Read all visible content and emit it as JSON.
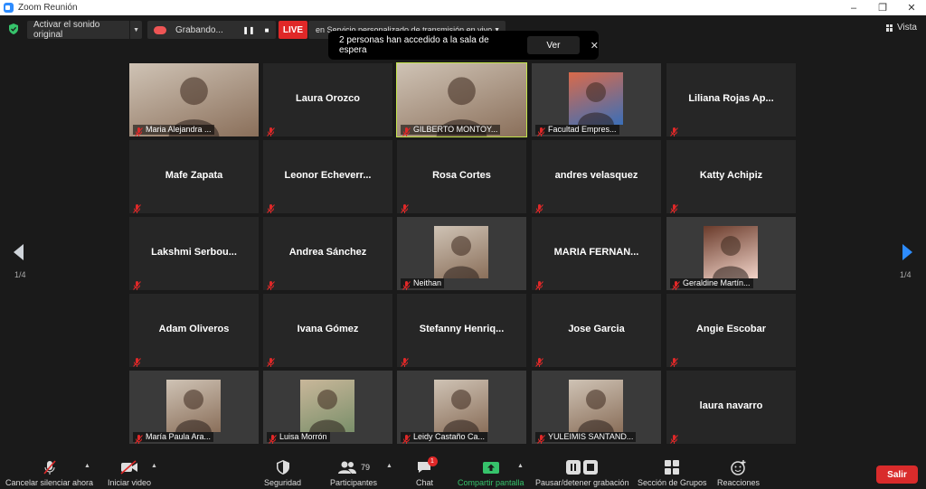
{
  "window": {
    "title": "Zoom Reunión",
    "controls": [
      "–",
      "❐",
      "✕"
    ]
  },
  "topbar": {
    "original_sound": "Activar el sonido original",
    "recording": "Grabando...",
    "live": "LIVE",
    "stream_service": "en Servicio personalizado de transmisión en vivo",
    "view": "Vista"
  },
  "notification": {
    "message": "2 personas han accedido a la sala de espera",
    "view_button": "Ver"
  },
  "gallery": {
    "page_left": "1/4",
    "page_right": "1/4",
    "tiles": [
      {
        "name": "Maria Alejandra ...",
        "video": true,
        "thumb": "portrait"
      },
      {
        "name": "Laura Orozco",
        "video": false
      },
      {
        "name": "GILBERTO MONTOY...",
        "video": true,
        "thumb": "portrait",
        "active": true
      },
      {
        "name": "Facultad Empres...",
        "video": true,
        "thumb": "apps"
      },
      {
        "name": "Liliana Rojas Ap...",
        "video": false
      },
      {
        "name": "Mafe Zapata",
        "video": false
      },
      {
        "name": "Leonor Echeverr...",
        "video": false
      },
      {
        "name": "Rosa Cortes",
        "video": false
      },
      {
        "name": "andres velasquez",
        "video": false
      },
      {
        "name": "Katty Achipiz",
        "video": false
      },
      {
        "name": "Lakshmi Serbou...",
        "video": false
      },
      {
        "name": "Andrea Sánchez",
        "video": false
      },
      {
        "name": "Neithan",
        "video": true,
        "thumb": "portrait"
      },
      {
        "name": "MARIA FERNAN...",
        "video": false
      },
      {
        "name": "Geraldine Martín...",
        "video": true,
        "thumb": "avatar"
      },
      {
        "name": "Adam Oliveros",
        "video": false
      },
      {
        "name": "Ivana Gómez",
        "video": false
      },
      {
        "name": "Stefanny Henriq...",
        "video": false
      },
      {
        "name": "Jose Garcia",
        "video": false
      },
      {
        "name": "Angie Escobar",
        "video": false
      },
      {
        "name": "María Paula Ara...",
        "video": true,
        "thumb": "portrait"
      },
      {
        "name": "Luisa Morrón",
        "video": true,
        "thumb": "group"
      },
      {
        "name": "Leidy Castaño Ca...",
        "video": true,
        "thumb": "portrait"
      },
      {
        "name": "YULEIMIS SANTAND...",
        "video": true,
        "thumb": "portrait"
      },
      {
        "name": "laura navarro",
        "video": false
      }
    ]
  },
  "toolbar": {
    "unmute": "Cancelar silenciar ahora",
    "start_video": "Iniciar video",
    "security": "Seguridad",
    "participants": "Participantes",
    "participants_count": "79",
    "chat": "Chat",
    "chat_badge": "1",
    "share_screen": "Compartir pantalla",
    "pause_recording": "Pausar/detener grabación",
    "breakout_rooms": "Sección de Grupos",
    "reactions": "Reacciones",
    "leave": "Salir"
  },
  "colors": {
    "accent": "#2d8cff",
    "live_red": "#e02828",
    "active_speaker": "#c3e34b",
    "share_green": "#36c36b"
  }
}
